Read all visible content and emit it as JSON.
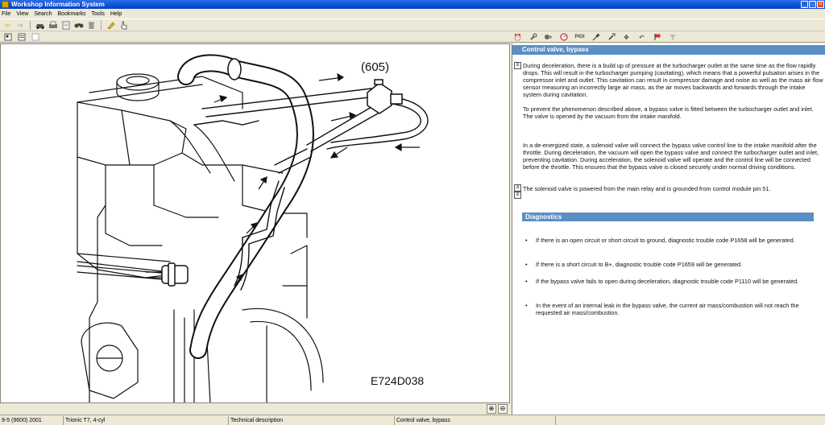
{
  "window": {
    "title": "Workshop Information System"
  },
  "menu": [
    "File",
    "View",
    "Search",
    "Bookmarks",
    "Tools",
    "Help"
  ],
  "figure": {
    "callout_label": "(605)",
    "image_id": "E724D038"
  },
  "document": {
    "section_title": "Control valve, bypass",
    "paragraphs": [
      "During deceleration, there is a build up of pressure at the turbocharger outlet at the same time as the flow rapidly drops. This will result in the turbocharger pumping (cavitating), which means that a powerful pulsation arises in the compressor inlet and outlet. This cavitation can result in compressor damage and noise as well as the mass air flow sensor measuring an incorrectly large air mass, as the air moves backwards and forwards through the intake system during cavitation.",
      "To prevent the phenomenon described above, a bypass valve is fitted between the turbocharger outlet and inlet. The valve is opened by the vacuum from the intake manifold.",
      "In a de-energized state, a solenoid valve will connect the bypass valve control line to the intake manifold after the throttle. During deceleration, the vacuum will open the bypass valve and connect the turbocharger outlet and inlet, preventing cavitation. During acceleration, the solenoid valve will operate and the control line will be connected before the throttle. This ensures that the bypass valve is closed securely under normal driving conditions.",
      "The solenoid valve is powered from the main relay and is grounded from control module pin 51."
    ],
    "diagnostics_title": "Diagnostics",
    "bullets": [
      "If there is an open circuit or short circuit to ground, diagnostic trouble code P1658 will be generated.",
      "If there is a short circuit to B+, diagnostic trouble code P1659 will be generated.",
      "If the bypass valve fails to open during deceleration, diagnostic trouble code P1110 will be generated.",
      "In the event of an internal leak in the bypass valve, the current air mass/combustion will not reach the requested air mass/combustion."
    ]
  },
  "toolbar": {
    "pioi_label": "PIOI",
    "pioi_label_right": "PIOI"
  },
  "status": {
    "vehicle": "9-5 (9600) 2001",
    "engine": "Trionic T7, 4-cyl",
    "doc_type": "Technical description",
    "topic": "Control valve, bypass"
  }
}
